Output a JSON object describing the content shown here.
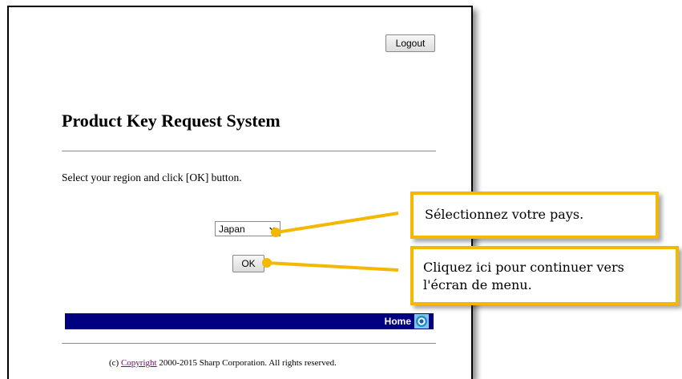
{
  "header": {
    "logout_label": "Logout"
  },
  "main": {
    "title": "Product Key Request System",
    "instruction": "Select your region and click [OK] button.",
    "region_select": {
      "selected": "Japan"
    },
    "ok_label": "OK"
  },
  "navbar": {
    "home_label": "Home",
    "background": "#000080"
  },
  "footer": {
    "prefix": "(c) ",
    "copyright_link": "Copyright",
    "suffix": " 2000-2015 Sharp Corporation. All rights reserved."
  },
  "callouts": {
    "select_country": "Sélectionnez votre pays.",
    "continue_menu_line1": "Cliquez ici pour continuer vers",
    "continue_menu_line2": "l'écran de menu."
  },
  "colors": {
    "callout_border": "#f5b800",
    "link_visited": "#800080"
  }
}
